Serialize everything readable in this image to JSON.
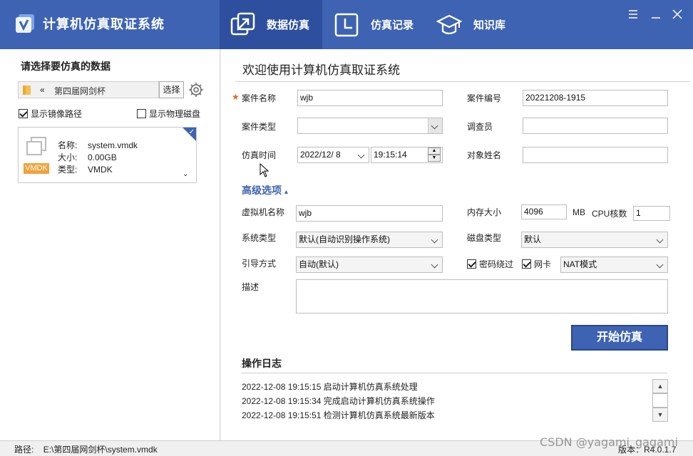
{
  "app": {
    "title": "计算机仿真取证系统",
    "accent_color": "#3e63b3",
    "active_tab_color": "#2d4f9d"
  },
  "nav": {
    "tabs": [
      {
        "label": "数据仿真",
        "icon": "external-link-icon",
        "active": true
      },
      {
        "label": "仿真记录",
        "icon": "clock-icon",
        "active": false
      },
      {
        "label": "知识库",
        "icon": "graduation-cap-icon",
        "active": false
      }
    ]
  },
  "left": {
    "title": "请选择要仿真的数据",
    "path_chevron": "«",
    "path_text": "第四届网剑杯",
    "choose_label": "选择",
    "show_mirror_label": "显示镜像路径",
    "show_mirror_checked": true,
    "show_disk_label": "显示物理磁盘",
    "show_disk_checked": false,
    "file": {
      "badge": "VMDK",
      "name_key": "名称:",
      "name_val": "system.vmdk",
      "size_key": "大小:",
      "size_val": "0.00GB",
      "type_key": "类型:",
      "type_val": "VMDK"
    }
  },
  "main": {
    "welcome": "欢迎使用计算机仿真取证系统",
    "case_name_label": "案件名称",
    "case_name_value": "wjb",
    "case_no_label": "案件编号",
    "case_no_value": "20221208-1915",
    "case_type_label": "案件类型",
    "case_type_value": "",
    "investigator_label": "调查员",
    "investigator_value": "",
    "sim_time_label": "仿真时间",
    "sim_date_value": "2022/12/  8",
    "sim_time_value": "19:15:14",
    "subject_label": "对象姓名",
    "subject_value": "",
    "advanced_label": "高级选项",
    "vm_name_label": "虚拟机名称",
    "vm_name_value": "wjb",
    "mem_label": "内存大小",
    "mem_value": "4096",
    "mem_unit": "MB",
    "cpu_label": "CPU核数",
    "cpu_value": "1",
    "os_type_label": "系统类型",
    "os_type_value": "默认(自动识别操作系统)",
    "disk_type_label": "磁盘类型",
    "disk_type_value": "默认",
    "boot_label": "引导方式",
    "boot_value": "自动(默认)",
    "pwd_bypass_label": "密码绕过",
    "pwd_bypass_checked": true,
    "nic_label": "网卡",
    "nic_checked": true,
    "nic_mode_value": "NAT模式",
    "desc_label": "描述",
    "start_label": "开始仿真"
  },
  "log": {
    "title": "操作日志",
    "lines": [
      "2022-12-08 19:15:15  启动计算机仿真系统处理",
      "2022-12-08 19:15:34  完成启动计算机仿真系统操作",
      "2022-12-08 19:15:51  检测计算机仿真系统最新版本"
    ]
  },
  "status": {
    "path_label": "路径:",
    "path_value": "E:\\第四届网剑杯\\system.vmdk",
    "version": "版本：R4.0.1.7"
  },
  "watermark": "CSDN @yagami_gagami"
}
